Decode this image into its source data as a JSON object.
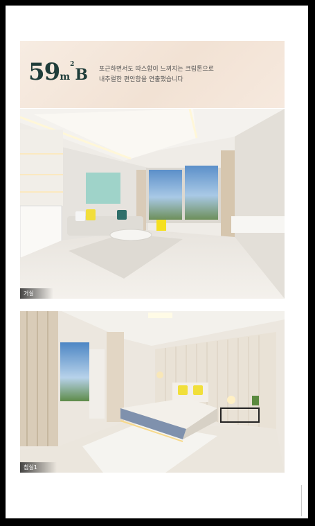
{
  "header": {
    "size_number": "59",
    "size_unit": "m",
    "size_sup": "2",
    "size_type": "B",
    "description_line1": "포근하면서도 따스함이 느껴지는 크림톤으로",
    "description_line2": "내추럴한 편안함을 연출했습니다"
  },
  "photos": [
    {
      "caption": "거실"
    },
    {
      "caption": "침실1"
    }
  ]
}
